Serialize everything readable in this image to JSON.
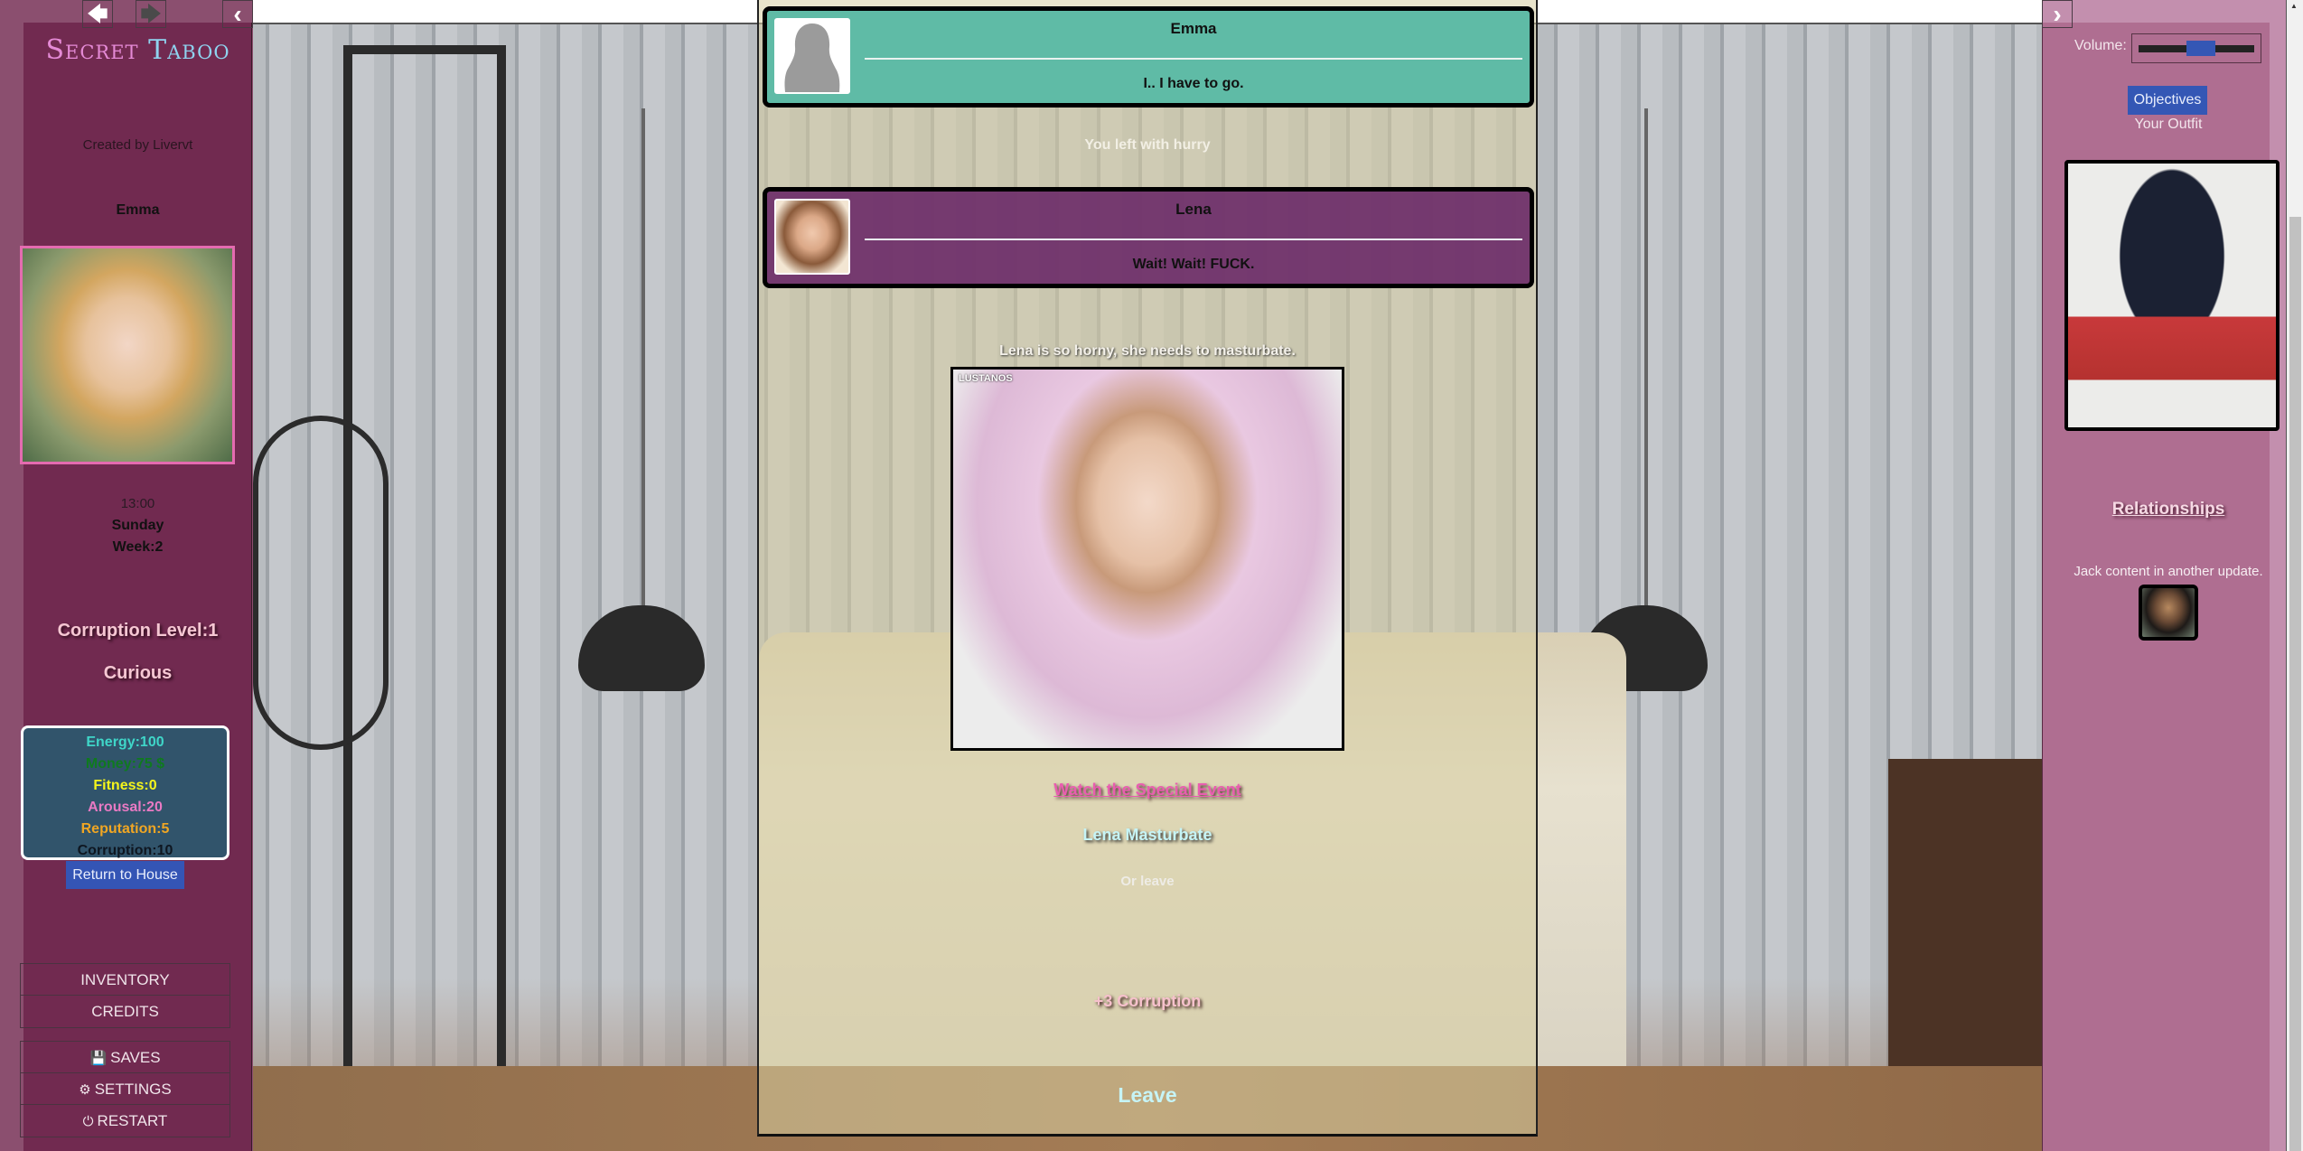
{
  "header": {
    "title_part1": "Secret",
    "title_part2": "Taboo",
    "created_by": "Created by Livervt",
    "nav": {
      "back_icon": "arrow-left-icon",
      "forward_icon": "arrow-right-icon",
      "collapse_left_icon": "chevron-left-icon",
      "collapse_right_icon": "chevron-right-icon",
      "back_glyph": "🡄",
      "forward_glyph": "🡆",
      "collapse_left_glyph": "‹",
      "collapse_right_glyph": "›"
    }
  },
  "character": {
    "name": "Emma",
    "time": "13:00",
    "day": "Sunday",
    "week": "Week:2",
    "corruption_level": "Corruption Level:1",
    "corruption_title": "Curious"
  },
  "stats": [
    {
      "label": "Energy:100",
      "color": "#3fd6c8"
    },
    {
      "label": "Money:75 $",
      "color": "#0f7a1f"
    },
    {
      "label": "Fitness:0",
      "color": "#f4f41c"
    },
    {
      "label": "Arousal:20",
      "color": "#e97ac4"
    },
    {
      "label": "Reputation:5",
      "color": "#f0a623"
    },
    {
      "label": "Corruption:10",
      "color": "#0e1620"
    }
  ],
  "buttons": {
    "return_house": "Return to House",
    "objectives": "Objectives"
  },
  "menu": {
    "group1": [
      {
        "label": "INVENTORY",
        "icon": ""
      },
      {
        "label": "CREDITS",
        "icon": ""
      }
    ],
    "group2": [
      {
        "label": "SAVES",
        "icon": "💾",
        "icon_name": "floppy-disk-icon"
      },
      {
        "label": "SETTINGS",
        "icon": "⚙",
        "icon_name": "gear-icon"
      },
      {
        "label": "RESTART",
        "icon": "⏻",
        "icon_name": "power-icon"
      }
    ]
  },
  "story": {
    "dialogs": [
      {
        "speaker": "Emma",
        "line": "I.. I have to go.",
        "bg": "#5fbba6"
      },
      {
        "speaker": "Lena",
        "line": "Wait! Wait! FUCK.",
        "bg": "#70326c"
      }
    ],
    "narration_left": "You left with hurry",
    "narration_horny": "Lena is so horny, she needs to masturbate.",
    "image_watermark": "LUSTANOS",
    "choices": {
      "watch_event": "Watch the Special Event",
      "lena_masturbate": "Lena Masturbate",
      "or_leave": "Or leave",
      "plus_corruption": "+3 Corruption",
      "leave": "Leave"
    }
  },
  "right_panel": {
    "volume_label": "Volume:",
    "volume_value": 0.55,
    "your_outfit": "Your Outfit",
    "relationships": "Relationships",
    "jack_note": "Jack content in another update."
  }
}
